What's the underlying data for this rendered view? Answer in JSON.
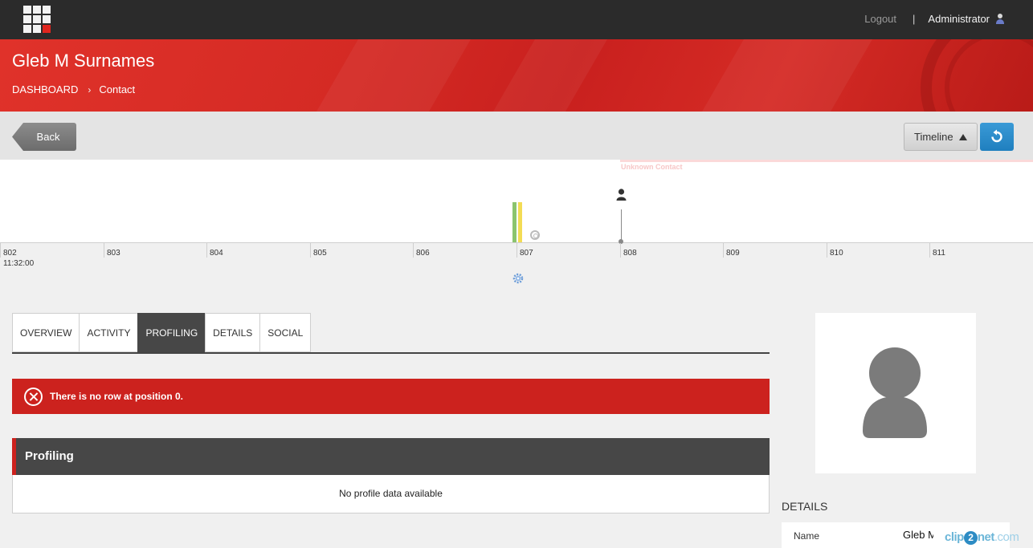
{
  "header": {
    "logout_label": "Logout",
    "separator": "|",
    "user_name": "Administrator"
  },
  "banner": {
    "title": "Gleb M Surnames",
    "breadcrumb": [
      {
        "label": "DASHBOARD"
      },
      {
        "label": "Contact"
      }
    ],
    "breadcrumb_separator": "›"
  },
  "toolbar": {
    "back_label": "Back",
    "timeline_label": "Timeline"
  },
  "timeline": {
    "unknown_contact_label": "Unknown Contact",
    "ticks": [
      "802",
      "803",
      "804",
      "805",
      "806",
      "807",
      "808",
      "809",
      "810",
      "811"
    ],
    "start_time": "11:32:00",
    "event_bars": [
      {
        "color": "#8cc46e"
      },
      {
        "color": "#f3dc55"
      }
    ]
  },
  "tabs": [
    {
      "label": "OVERVIEW",
      "active": false
    },
    {
      "label": "ACTIVITY",
      "active": false
    },
    {
      "label": "PROFILING",
      "active": true
    },
    {
      "label": "DETAILS",
      "active": false
    },
    {
      "label": "SOCIAL",
      "active": false
    }
  ],
  "error": {
    "message": "There is no row at position 0."
  },
  "profiling": {
    "title": "Profiling",
    "empty_message": "No profile data available"
  },
  "details": {
    "title": "DETAILS",
    "rows": [
      {
        "label": "Name",
        "value": "Gleb M"
      }
    ]
  },
  "watermark": {
    "prefix": "clip",
    "two": "2",
    "suffix": "net",
    "domain": ".com"
  },
  "colors": {
    "accent_red": "#cc221e",
    "refresh_blue": "#1f7fbf",
    "dark": "#474747"
  }
}
